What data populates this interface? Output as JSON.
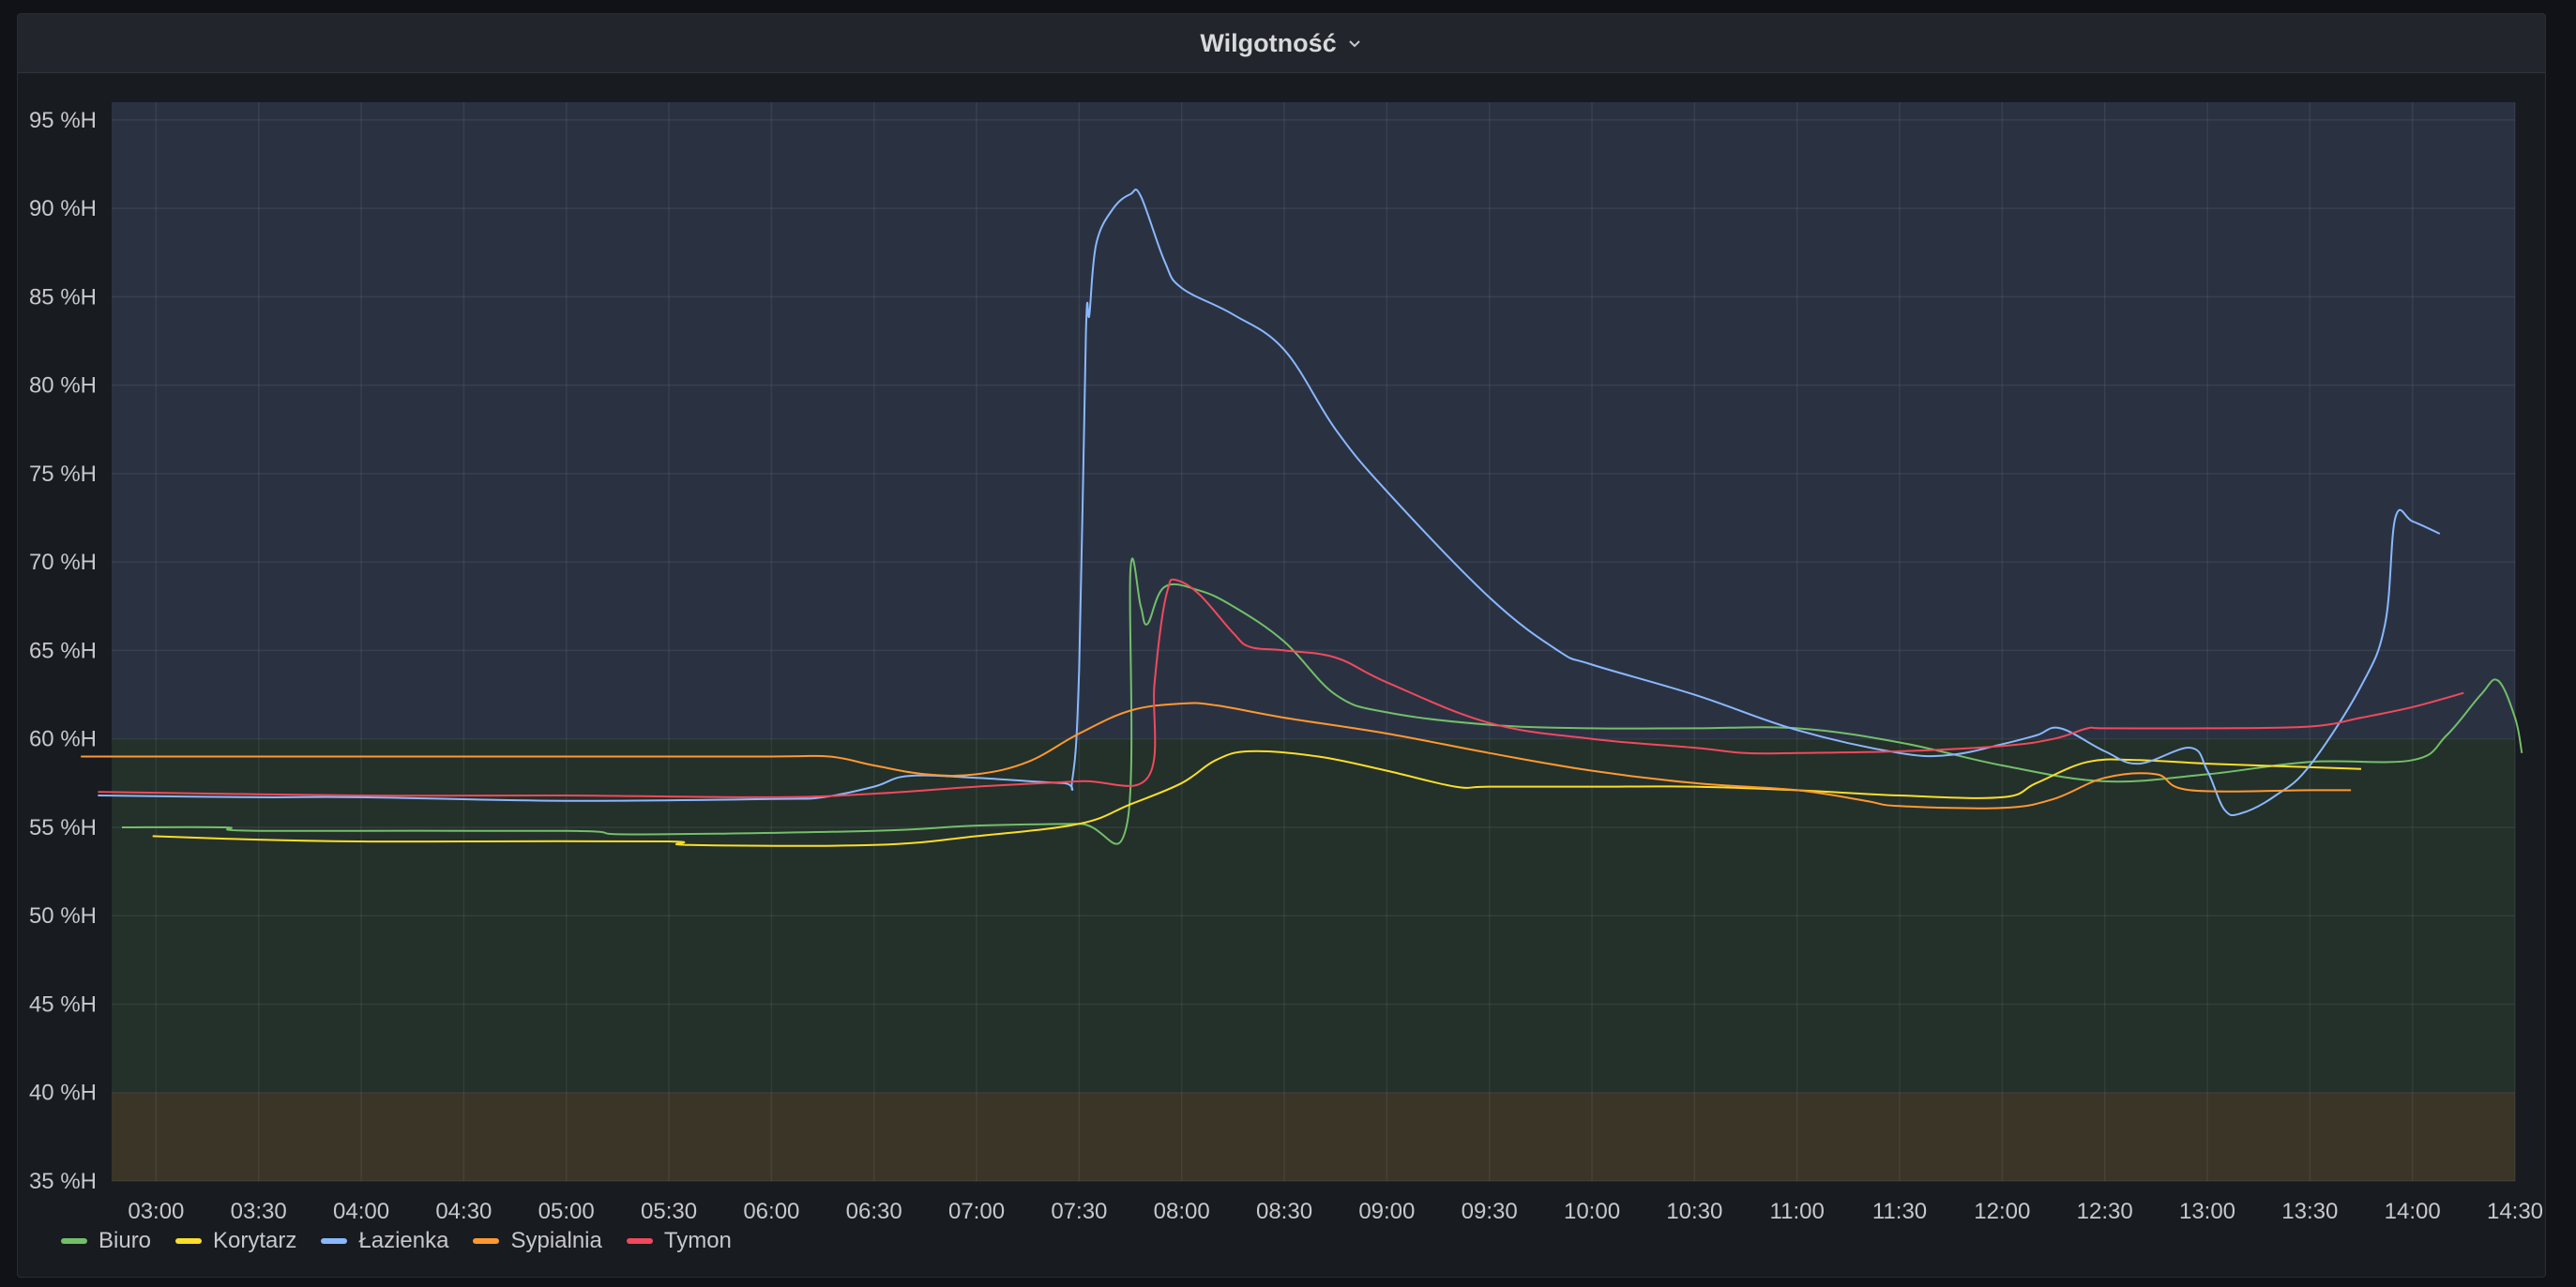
{
  "panel": {
    "title": "Wilgotność"
  },
  "chart_data": {
    "type": "line",
    "title": "Wilgotność",
    "ylim": [
      35,
      96
    ],
    "xlim": [
      "02:47",
      "14:30"
    ],
    "grid": true,
    "legend_position": "bottom-left",
    "y_ticks": [
      {
        "value": 35,
        "label": "35 %H"
      },
      {
        "value": 40,
        "label": "40 %H"
      },
      {
        "value": 45,
        "label": "45 %H"
      },
      {
        "value": 50,
        "label": "50 %H"
      },
      {
        "value": 55,
        "label": "55 %H"
      },
      {
        "value": 60,
        "label": "60 %H"
      },
      {
        "value": 65,
        "label": "65 %H"
      },
      {
        "value": 70,
        "label": "70 %H"
      },
      {
        "value": 75,
        "label": "75 %H"
      },
      {
        "value": 80,
        "label": "80 %H"
      },
      {
        "value": 85,
        "label": "85 %H"
      },
      {
        "value": 90,
        "label": "90 %H"
      },
      {
        "value": 95,
        "label": "95 %H"
      }
    ],
    "x_ticks": [
      "03:00",
      "03:30",
      "04:00",
      "04:30",
      "05:00",
      "05:30",
      "06:00",
      "06:30",
      "07:00",
      "07:30",
      "08:00",
      "08:30",
      "09:00",
      "09:30",
      "10:00",
      "10:30",
      "11:00",
      "11:30",
      "12:00",
      "12:30",
      "13:00",
      "13:30",
      "14:00",
      "14:30"
    ],
    "thresholds": [
      {
        "from": 35,
        "to": 40,
        "color": "#3a3526"
      },
      {
        "from": 40,
        "to": 60,
        "color": "#24302a"
      },
      {
        "from": 60,
        "to": 96,
        "color": "#2a3242"
      }
    ],
    "series": [
      {
        "name": "Biuro",
        "color": "#73bf69",
        "points": [
          [
            "02:50",
            55.0
          ],
          [
            "03:20",
            55.0
          ],
          [
            "03:30",
            54.8
          ],
          [
            "05:00",
            54.8
          ],
          [
            "05:20",
            54.6
          ],
          [
            "06:30",
            54.8
          ],
          [
            "07:00",
            55.1
          ],
          [
            "07:30",
            55.2
          ],
          [
            "07:44",
            55.2
          ],
          [
            "07:45",
            69.5
          ],
          [
            "07:48",
            67.5
          ],
          [
            "07:50",
            66.5
          ],
          [
            "07:55",
            68.6
          ],
          [
            "08:05",
            68.4
          ],
          [
            "08:15",
            67.5
          ],
          [
            "08:30",
            65.5
          ],
          [
            "08:45",
            62.5
          ],
          [
            "09:00",
            61.5
          ],
          [
            "09:30",
            60.8
          ],
          [
            "10:00",
            60.6
          ],
          [
            "10:30",
            60.6
          ],
          [
            "11:00",
            60.6
          ],
          [
            "11:30",
            59.8
          ],
          [
            "12:00",
            58.5
          ],
          [
            "12:30",
            57.6
          ],
          [
            "13:00",
            58.0
          ],
          [
            "13:30",
            58.7
          ],
          [
            "14:00",
            58.8
          ],
          [
            "14:10",
            60.2
          ],
          [
            "14:20",
            62.5
          ],
          [
            "14:25",
            63.3
          ],
          [
            "14:30",
            61.2
          ],
          [
            "14:32",
            59.2
          ]
        ]
      },
      {
        "name": "Korytarz",
        "color": "#fade2a",
        "points": [
          [
            "02:59",
            54.5
          ],
          [
            "03:30",
            54.3
          ],
          [
            "04:00",
            54.2
          ],
          [
            "04:30",
            54.2
          ],
          [
            "05:30",
            54.2
          ],
          [
            "05:36",
            54.0
          ],
          [
            "06:30",
            54.0
          ],
          [
            "07:00",
            54.5
          ],
          [
            "07:30",
            55.2
          ],
          [
            "07:45",
            56.3
          ],
          [
            "08:00",
            57.5
          ],
          [
            "08:10",
            58.8
          ],
          [
            "08:20",
            59.3
          ],
          [
            "08:40",
            59.0
          ],
          [
            "09:00",
            58.2
          ],
          [
            "09:20",
            57.3
          ],
          [
            "09:30",
            57.3
          ],
          [
            "10:00",
            57.3
          ],
          [
            "10:30",
            57.3
          ],
          [
            "11:00",
            57.1
          ],
          [
            "11:30",
            56.8
          ],
          [
            "12:00",
            56.7
          ],
          [
            "12:10",
            57.5
          ],
          [
            "12:25",
            58.7
          ],
          [
            "12:40",
            58.8
          ],
          [
            "13:00",
            58.6
          ],
          [
            "13:30",
            58.4
          ],
          [
            "13:45",
            58.3
          ]
        ]
      },
      {
        "name": "Łazienka",
        "color": "#8ab8ff",
        "points": [
          [
            "02:43",
            56.8
          ],
          [
            "03:30",
            56.7
          ],
          [
            "04:00",
            56.7
          ],
          [
            "05:00",
            56.5
          ],
          [
            "06:00",
            56.6
          ],
          [
            "06:15",
            56.7
          ],
          [
            "06:30",
            57.3
          ],
          [
            "06:40",
            57.9
          ],
          [
            "07:00",
            57.8
          ],
          [
            "07:25",
            57.5
          ],
          [
            "07:28",
            57.7
          ],
          [
            "07:30",
            64.0
          ],
          [
            "07:32",
            83.0
          ],
          [
            "07:33",
            84.0
          ],
          [
            "07:35",
            88.0
          ],
          [
            "07:40",
            90.0
          ],
          [
            "07:45",
            90.8
          ],
          [
            "07:48",
            90.7
          ],
          [
            "07:55",
            87.0
          ],
          [
            "08:00",
            85.5
          ],
          [
            "08:15",
            84.0
          ],
          [
            "08:30",
            82.0
          ],
          [
            "08:45",
            77.5
          ],
          [
            "09:00",
            74.0
          ],
          [
            "09:30",
            68.0
          ],
          [
            "09:50",
            65.0
          ],
          [
            "10:00",
            64.2
          ],
          [
            "10:30",
            62.5
          ],
          [
            "11:00",
            60.5
          ],
          [
            "11:30",
            59.2
          ],
          [
            "11:45",
            59.1
          ],
          [
            "12:00",
            59.7
          ],
          [
            "12:10",
            60.2
          ],
          [
            "12:17",
            60.6
          ],
          [
            "12:30",
            59.3
          ],
          [
            "12:40",
            58.6
          ],
          [
            "12:55",
            59.5
          ],
          [
            "13:00",
            58.2
          ],
          [
            "13:05",
            56.0
          ],
          [
            "13:10",
            55.8
          ],
          [
            "13:20",
            56.8
          ],
          [
            "13:30",
            58.5
          ],
          [
            "13:45",
            63.0
          ],
          [
            "13:52",
            66.5
          ],
          [
            "13:55",
            72.5
          ],
          [
            "14:00",
            72.3
          ],
          [
            "14:08",
            71.6
          ]
        ]
      },
      {
        "name": "Sypialnia",
        "color": "#ff9830",
        "points": [
          [
            "02:38",
            59.0
          ],
          [
            "03:30",
            59.0
          ],
          [
            "05:00",
            59.0
          ],
          [
            "06:00",
            59.0
          ],
          [
            "06:17",
            59.0
          ],
          [
            "06:30",
            58.5
          ],
          [
            "06:45",
            58.0
          ],
          [
            "07:00",
            58.0
          ],
          [
            "07:15",
            58.7
          ],
          [
            "07:30",
            60.3
          ],
          [
            "07:45",
            61.6
          ],
          [
            "08:00",
            62.0
          ],
          [
            "08:10",
            61.9
          ],
          [
            "08:30",
            61.2
          ],
          [
            "09:00",
            60.3
          ],
          [
            "09:30",
            59.2
          ],
          [
            "10:00",
            58.2
          ],
          [
            "10:30",
            57.5
          ],
          [
            "11:00",
            57.1
          ],
          [
            "11:20",
            56.5
          ],
          [
            "11:30",
            56.2
          ],
          [
            "12:00",
            56.1
          ],
          [
            "12:15",
            56.6
          ],
          [
            "12:30",
            57.8
          ],
          [
            "12:45",
            58.0
          ],
          [
            "12:55",
            57.1
          ],
          [
            "13:30",
            57.1
          ],
          [
            "13:42",
            57.1
          ]
        ]
      },
      {
        "name": "Tymon",
        "color": "#f2495c",
        "points": [
          [
            "02:43",
            57.0
          ],
          [
            "04:00",
            56.8
          ],
          [
            "05:00",
            56.8
          ],
          [
            "06:00",
            56.7
          ],
          [
            "06:30",
            56.9
          ],
          [
            "07:00",
            57.3
          ],
          [
            "07:30",
            57.6
          ],
          [
            "07:50",
            57.8
          ],
          [
            "07:52",
            63.0
          ],
          [
            "07:54",
            66.5
          ],
          [
            "07:56",
            68.5
          ],
          [
            "07:58",
            69.0
          ],
          [
            "08:05",
            68.2
          ],
          [
            "08:15",
            66.0
          ],
          [
            "08:20",
            65.2
          ],
          [
            "08:30",
            65.0
          ],
          [
            "08:45",
            64.6
          ],
          [
            "09:00",
            63.2
          ],
          [
            "09:30",
            60.9
          ],
          [
            "10:00",
            60.0
          ],
          [
            "10:30",
            59.5
          ],
          [
            "10:45",
            59.2
          ],
          [
            "11:00",
            59.2
          ],
          [
            "11:30",
            59.3
          ],
          [
            "12:00",
            59.6
          ],
          [
            "12:15",
            60.0
          ],
          [
            "12:25",
            60.6
          ],
          [
            "12:30",
            60.6
          ],
          [
            "13:00",
            60.6
          ],
          [
            "13:30",
            60.7
          ],
          [
            "13:45",
            61.2
          ],
          [
            "14:00",
            61.8
          ],
          [
            "14:15",
            62.6
          ]
        ]
      }
    ]
  }
}
